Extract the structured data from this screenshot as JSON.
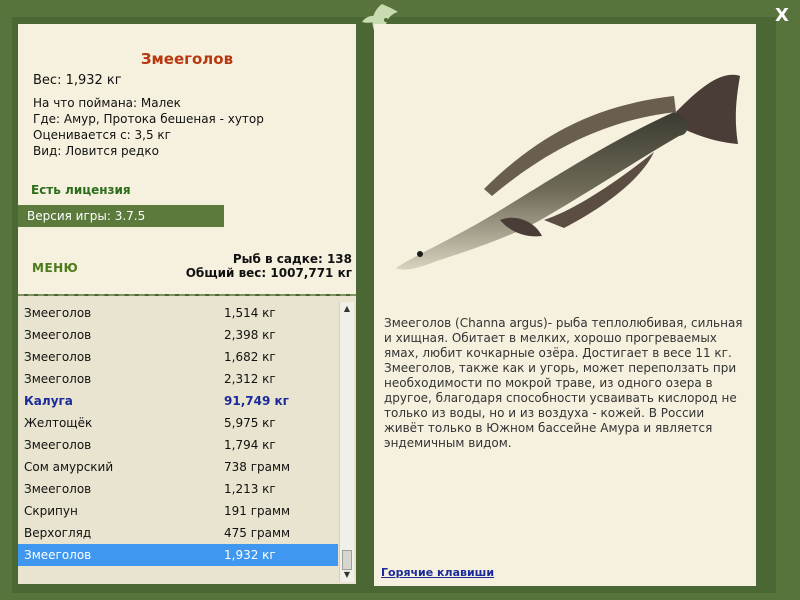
{
  "fish": {
    "name": "Змееголов",
    "weight": "Вес: 1,932 кг",
    "bait": "На что поймана: Малек",
    "where": "Где: Амур, Протока бешеная - хутор",
    "value": "Оценивается с: 3,5 кг",
    "kind": "Вид: Ловится редко"
  },
  "license": "Есть лицензия",
  "version": "Версия игры: 3.7.5",
  "menu_label": "МЕНЮ",
  "stats": {
    "count": "Рыб в садке: 138",
    "total": "Общий вес: 1007,771 кг"
  },
  "catch_list": [
    {
      "name": "Змееголов",
      "weight": "1,514 кг"
    },
    {
      "name": "Змееголов",
      "weight": "2,398 кг"
    },
    {
      "name": "Змееголов",
      "weight": "1,682 кг"
    },
    {
      "name": "Змееголов",
      "weight": "2,312 кг"
    },
    {
      "name": "Калуга",
      "weight": "91,749 кг"
    },
    {
      "name": "Желтощёк",
      "weight": "5,975 кг"
    },
    {
      "name": "Змееголов",
      "weight": "1,794 кг"
    },
    {
      "name": "Сом амурский",
      "weight": "738 грамм"
    },
    {
      "name": "Змееголов",
      "weight": "1,213 кг"
    },
    {
      "name": "Скрипун",
      "weight": "191 грамм"
    },
    {
      "name": "Верхогляд",
      "weight": "475 грамм"
    },
    {
      "name": "Змееголов",
      "weight": "1,932 кг"
    }
  ],
  "description": "Змееголов (Channa argus)- рыба теплолюбивая, сильная и хищная. Обитает в мелких, хорошо прогреваемых ямах, любит кочкарные озёра. Достигает в весе 11 кг. Змееголов, также как и угорь, может переползать при необходимости по мокрой траве, из одного озера в другое, благодаря способности усваивать кислород не только из воды, но и из воздуха - кожей. В России живёт только в Южном бассейне Амура и является эндемичным видом.",
  "hotkeys": "Горячие клавиши",
  "close_label": "X"
}
